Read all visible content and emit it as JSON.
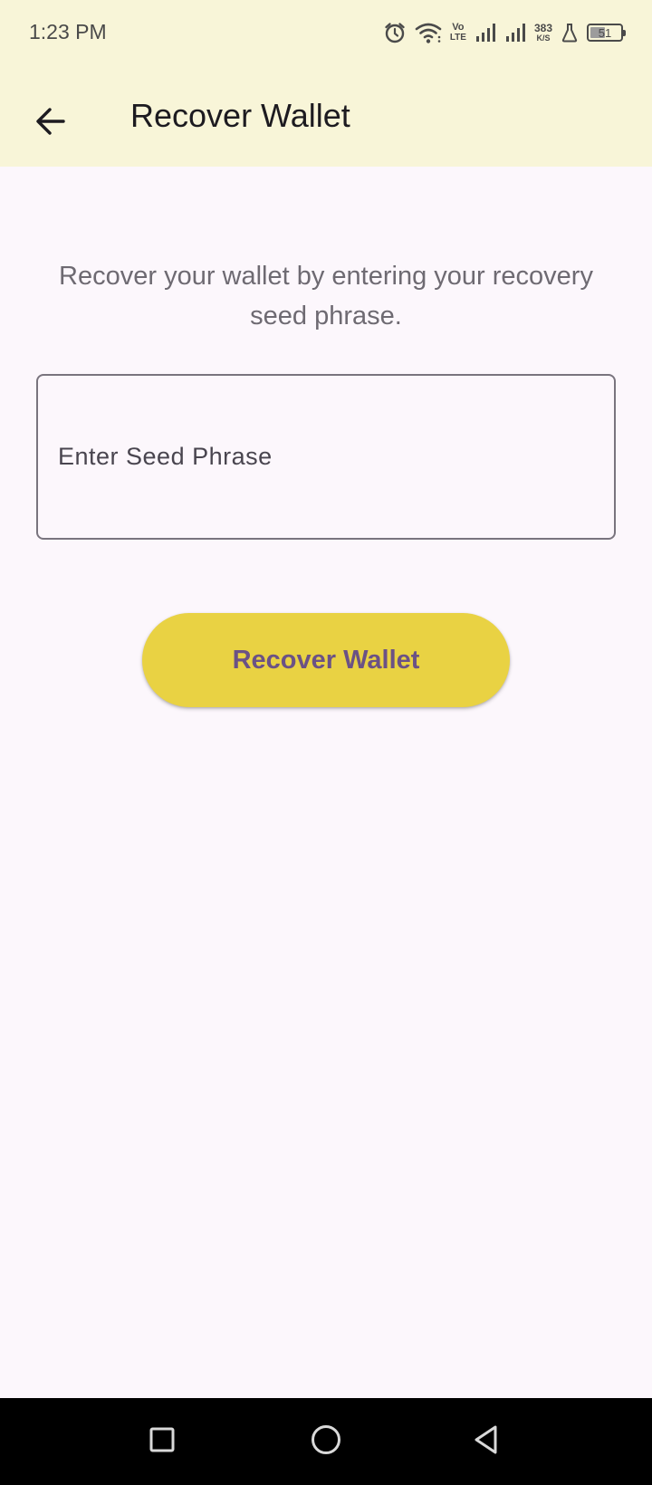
{
  "status_bar": {
    "time": "1:23 PM",
    "volte_top": "Vo",
    "volte_bottom": "LTE",
    "net_speed_value": "383",
    "net_speed_unit": "K/S",
    "battery_level": "51",
    "battery_fraction": 0.51,
    "icons": [
      "alarm-icon",
      "wifi-icon",
      "volte-icon",
      "signal-icon",
      "signal-icon",
      "flask-icon",
      "battery-icon"
    ]
  },
  "app_bar": {
    "back_icon": "arrow-left-icon",
    "title": "Recover Wallet"
  },
  "main": {
    "description": "Recover your wallet by entering your recovery seed phrase.",
    "seed_input": {
      "placeholder": "Enter Seed Phrase",
      "value": ""
    },
    "recover_button_label": "Recover Wallet"
  },
  "nav_bar": {
    "buttons": [
      "recents-square-icon",
      "home-circle-icon",
      "back-triangle-icon"
    ]
  },
  "colors": {
    "app_bar_bg": "#F8F5D8",
    "page_bg": "#FCF7FC",
    "button_bg": "#E9D243",
    "button_text": "#6B5285",
    "outline": "#79747E"
  }
}
